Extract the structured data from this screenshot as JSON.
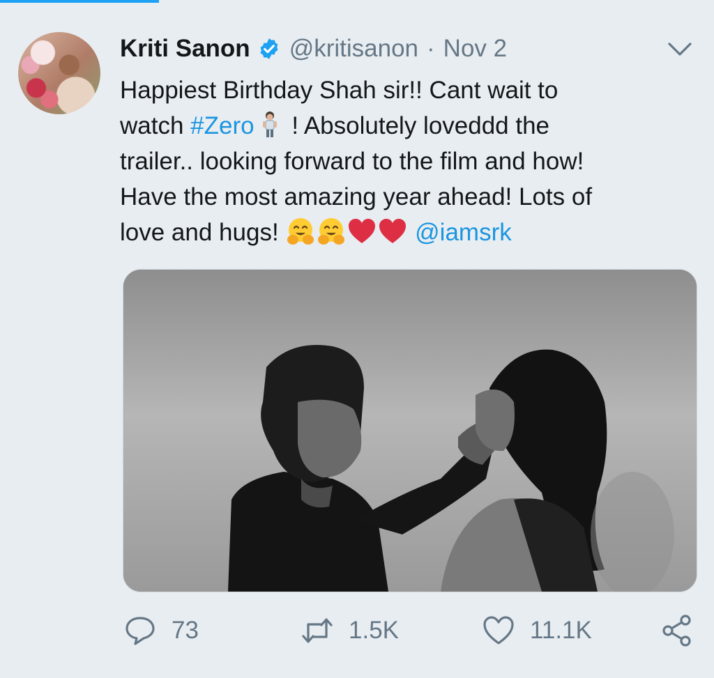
{
  "tweet": {
    "author_name": "Kriti Sanon",
    "handle": "@kritisanon",
    "separator": "·",
    "date": "Nov 2",
    "text": {
      "line1": "Happiest Birthday Shah sir!! Cant wait to",
      "line2_before": "watch ",
      "hashtag": "#Zero",
      "line2_after": " ! Absolutely loveddd the",
      "line3": "trailer.. looking forward to the film and how!",
      "line4": "Have the most amazing year ahead! Lots of",
      "line5_before": "love and hugs! ",
      "mention": "@iamsrk"
    },
    "emojis": [
      "zero-hashflag-emoji",
      "hugging-face-emoji",
      "hugging-face-emoji",
      "red-heart-emoji",
      "red-heart-emoji"
    ],
    "media": {
      "type": "black-and-white photo"
    }
  },
  "actions": {
    "replies": "73",
    "retweets": "1.5K",
    "likes": "11.1K"
  },
  "colors": {
    "background": "#e8edf1",
    "accent": "#1da1f2",
    "link": "#1b95e0",
    "secondary_text": "#657786",
    "heart": "#e0245e"
  }
}
